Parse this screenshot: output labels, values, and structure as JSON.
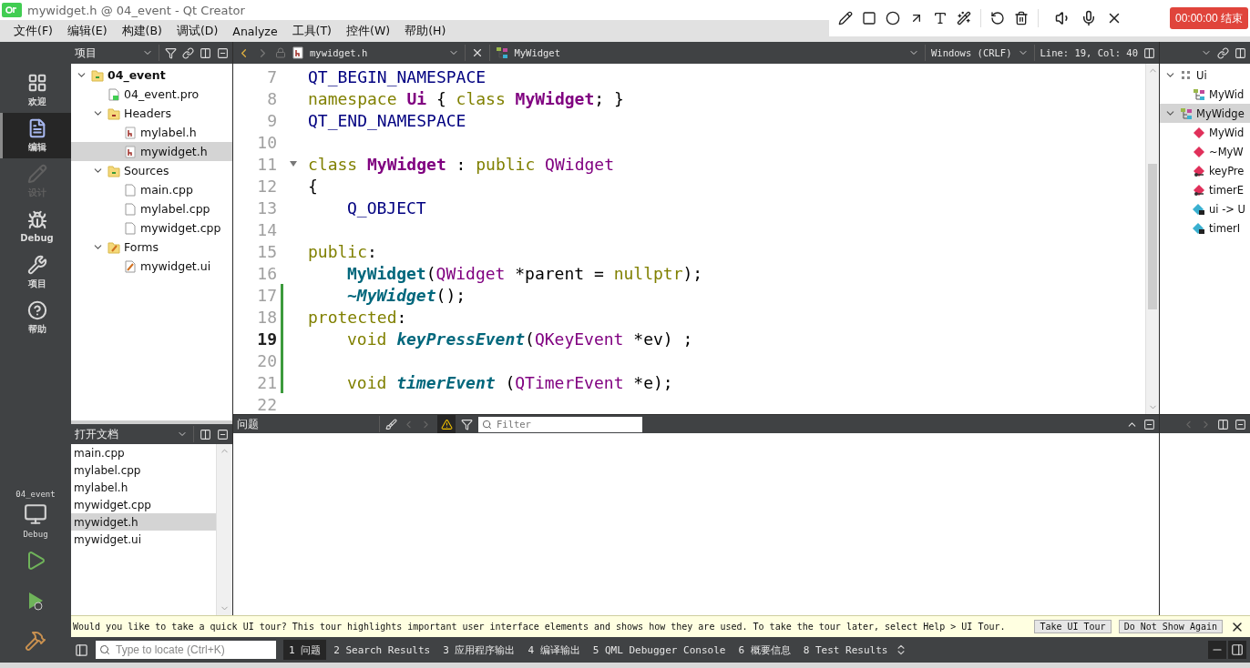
{
  "window": {
    "title": "mywidget.h @ 04_event - Qt Creator"
  },
  "recorder": {
    "timer": "00:00:00 结束"
  },
  "menu": [
    "文件(F)",
    "编辑(E)",
    "构建(B)",
    "调试(D)",
    "Analyze",
    "工具(T)",
    "控件(W)",
    "帮助(H)"
  ],
  "modes": [
    {
      "label": "欢迎",
      "kind": "welcome",
      "selected": false,
      "disabled": false
    },
    {
      "label": "编辑",
      "kind": "edit",
      "selected": true,
      "disabled": false
    },
    {
      "label": "设计",
      "kind": "design",
      "selected": false,
      "disabled": true
    },
    {
      "label": "Debug",
      "kind": "debug",
      "selected": false,
      "disabled": false
    },
    {
      "label": "项目",
      "kind": "projects",
      "selected": false,
      "disabled": false
    },
    {
      "label": "帮助",
      "kind": "help",
      "selected": false,
      "disabled": false
    }
  ],
  "kit": {
    "project": "04_event",
    "build": "Debug"
  },
  "project_pane": {
    "title": "项目",
    "tree": [
      {
        "label": "04_event",
        "kind": "project",
        "expanded": true,
        "selected": false,
        "children": [
          {
            "label": "04_event.pro",
            "kind": "pro",
            "selected": false
          },
          {
            "label": "Headers",
            "kind": "folder-h",
            "expanded": true,
            "selected": false,
            "children": [
              {
                "label": "mylabel.h",
                "kind": "header",
                "selected": false
              },
              {
                "label": "mywidget.h",
                "kind": "header",
                "selected": true
              }
            ]
          },
          {
            "label": "Sources",
            "kind": "folder-cpp",
            "expanded": true,
            "selected": false,
            "children": [
              {
                "label": "main.cpp",
                "kind": "source",
                "selected": false
              },
              {
                "label": "mylabel.cpp",
                "kind": "source",
                "selected": false
              },
              {
                "label": "mywidget.cpp",
                "kind": "source",
                "selected": false
              }
            ]
          },
          {
            "label": "Forms",
            "kind": "folder-form",
            "expanded": true,
            "selected": false,
            "children": [
              {
                "label": "mywidget.ui",
                "kind": "form",
                "selected": false
              }
            ]
          }
        ]
      }
    ]
  },
  "open_documents": {
    "title": "打开文档",
    "items": [
      {
        "label": "main.cpp",
        "selected": false
      },
      {
        "label": "mylabel.cpp",
        "selected": false
      },
      {
        "label": "mylabel.h",
        "selected": false
      },
      {
        "label": "mywidget.cpp",
        "selected": false
      },
      {
        "label": "mywidget.h",
        "selected": true
      },
      {
        "label": "mywidget.ui",
        "selected": false
      }
    ]
  },
  "editor": {
    "file": "mywidget.h",
    "symbol": "MyWidget",
    "line_ending": "Windows (CRLF)",
    "position": "Line: 19, Col: 40",
    "lines": [
      {
        "number": "7",
        "current": false,
        "changed": false,
        "foldable": false,
        "tokens": [
          {
            "text": "QT_BEGIN_NAMESPACE",
            "kind": "macro"
          }
        ]
      },
      {
        "number": "8",
        "current": false,
        "changed": false,
        "foldable": false,
        "tokens": [
          {
            "text": "namespace",
            "kind": "keyword"
          },
          {
            "text": " Ui",
            "kind": "classdef"
          },
          {
            "text": " { ",
            "kind": "plain"
          },
          {
            "text": "class",
            "kind": "keyword"
          },
          {
            "text": " MyWidget",
            "kind": "classdef"
          },
          {
            "text": "; }",
            "kind": "plain"
          }
        ]
      },
      {
        "number": "9",
        "current": false,
        "changed": false,
        "foldable": false,
        "tokens": [
          {
            "text": "QT_END_NAMESPACE",
            "kind": "macro"
          }
        ]
      },
      {
        "number": "10",
        "current": false,
        "changed": false,
        "foldable": false
      },
      {
        "number": "11",
        "current": false,
        "changed": false,
        "foldable": true,
        "tokens": [
          {
            "text": "class",
            "kind": "keyword"
          },
          {
            "text": " MyWidget",
            "kind": "classdef"
          },
          {
            "text": " : ",
            "kind": "plain"
          },
          {
            "text": "public",
            "kind": "keyword"
          },
          {
            "text": " QWidget",
            "kind": "type"
          }
        ]
      },
      {
        "number": "12",
        "current": false,
        "changed": false,
        "foldable": false,
        "tokens": [
          {
            "text": "{",
            "kind": "plain"
          }
        ]
      },
      {
        "number": "13",
        "current": false,
        "changed": false,
        "foldable": false,
        "indented": true,
        "tokens": [
          {
            "text": "Q_OBJECT",
            "kind": "macro"
          }
        ]
      },
      {
        "number": "14",
        "current": false,
        "changed": false,
        "foldable": false
      },
      {
        "number": "15",
        "current": false,
        "changed": false,
        "foldable": false,
        "tokens": [
          {
            "text": "public",
            "kind": "keyword"
          },
          {
            "text": ":",
            "kind": "plain"
          }
        ]
      },
      {
        "number": "16",
        "current": false,
        "changed": false,
        "foldable": false,
        "indented": true,
        "tokens": [
          {
            "text": "MyWidget",
            "kind": "function"
          },
          {
            "text": "(",
            "kind": "plain"
          },
          {
            "text": "QWidget",
            "kind": "type"
          },
          {
            "text": " *parent = ",
            "kind": "plain"
          },
          {
            "text": "nullptr",
            "kind": "keyword"
          },
          {
            "text": ");",
            "kind": "plain"
          }
        ]
      },
      {
        "number": "17",
        "current": false,
        "changed": true,
        "foldable": false,
        "indented": true,
        "tokens": [
          {
            "text": "~MyWidget",
            "kind": "virtual"
          },
          {
            "text": "();",
            "kind": "plain"
          }
        ]
      },
      {
        "number": "18",
        "current": false,
        "changed": true,
        "foldable": false,
        "tokens": [
          {
            "text": "protected",
            "kind": "keyword"
          },
          {
            "text": ":",
            "kind": "plain"
          }
        ]
      },
      {
        "number": "19",
        "current": true,
        "changed": true,
        "foldable": false,
        "indented": true,
        "tokens": [
          {
            "text": "void",
            "kind": "keyword"
          },
          {
            "text": " keyPressEvent",
            "kind": "virtual"
          },
          {
            "text": "(",
            "kind": "plain"
          },
          {
            "text": "QKeyEvent",
            "kind": "type"
          },
          {
            "text": " *ev) ;",
            "kind": "plain"
          }
        ]
      },
      {
        "number": "20",
        "current": false,
        "changed": true,
        "foldable": false
      },
      {
        "number": "21",
        "current": false,
        "changed": true,
        "foldable": false,
        "indented": true,
        "tokens": [
          {
            "text": "void",
            "kind": "keyword"
          },
          {
            "text": " timerEvent",
            "kind": "virtual"
          },
          {
            "text": " (",
            "kind": "plain"
          },
          {
            "text": "QTimerEvent",
            "kind": "type"
          },
          {
            "text": " *e);",
            "kind": "plain"
          }
        ]
      },
      {
        "number": "22",
        "current": false,
        "changed": false,
        "foldable": false
      }
    ]
  },
  "outline": {
    "tree": [
      {
        "label": "Ui",
        "kind": "namespace",
        "expanded": true,
        "selected": false,
        "children": [
          {
            "label": "MyWid",
            "kind": "class",
            "selected": false
          }
        ]
      },
      {
        "label": "MyWidge",
        "kind": "class",
        "expanded": true,
        "selected": true,
        "children": [
          {
            "label": "MyWid",
            "kind": "method",
            "selected": false
          },
          {
            "label": "~MyW",
            "kind": "method",
            "selected": false
          },
          {
            "label": "keyPre",
            "kind": "protected",
            "selected": false
          },
          {
            "label": "timerE",
            "kind": "protected",
            "selected": false
          },
          {
            "label": "ui -> U",
            "kind": "private",
            "selected": false
          },
          {
            "label": "timerI",
            "kind": "private",
            "selected": false
          }
        ]
      }
    ]
  },
  "issues": {
    "title": "问题",
    "filter_placeholder": "Filter"
  },
  "tour": {
    "message": "Would you like to take a quick UI tour? This tour highlights important user interface elements and shows how they are used. To take the tour later, select Help > UI Tour.",
    "buttons": [
      "Take UI Tour",
      "Do Not Show Again"
    ]
  },
  "status_bar": {
    "locate_placeholder": "Type to locate (Ctrl+K)",
    "tabs": [
      {
        "label": "1 问题",
        "selected": true
      },
      {
        "label": "2 Search Results",
        "selected": false
      },
      {
        "label": "3 应用程序输出",
        "selected": false
      },
      {
        "label": "4 编译输出",
        "selected": false
      },
      {
        "label": "5 QML Debugger Console",
        "selected": false
      },
      {
        "label": "6 概要信息",
        "selected": false
      },
      {
        "label": "8 Test Results",
        "selected": false
      }
    ]
  }
}
